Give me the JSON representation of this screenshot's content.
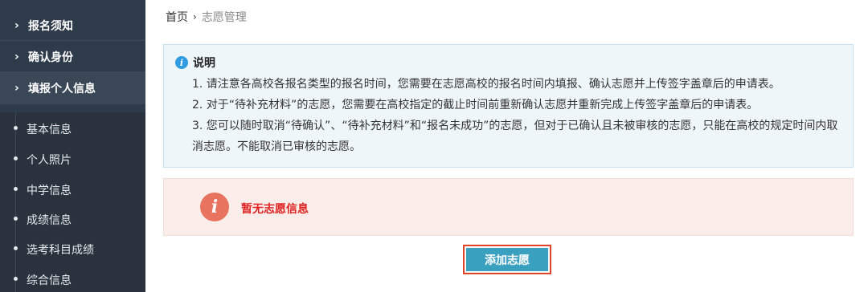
{
  "sidebar": {
    "sections": [
      {
        "label": "报名须知"
      },
      {
        "label": "确认身份"
      },
      {
        "label": "填报个人信息"
      }
    ],
    "subitems": [
      {
        "label": "基本信息"
      },
      {
        "label": "个人照片"
      },
      {
        "label": "中学信息"
      },
      {
        "label": "成绩信息"
      },
      {
        "label": "选考科目成绩"
      },
      {
        "label": "综合信息"
      }
    ]
  },
  "breadcrumb": {
    "home": "首页",
    "separator": "›",
    "current": "志愿管理"
  },
  "info": {
    "title": "说明",
    "lines": [
      "1. 请注意各高校各报名类型的报名时间，您需要在志愿高校的报名时间内填报、确认志愿并上传签字盖章后的申请表。",
      "2. 对于“待补充材料”的志愿，您需要在高校指定的截止时间前重新确认志愿并重新完成上传签字盖章后的申请表。",
      "3. 您可以随时取消“待确认”、“待补充材料”和“报名未成功”的志愿，但对于已确认且未被审核的志愿，只能在高校的规定时间内取消志愿。不能取消已审核的志愿。"
    ]
  },
  "notice": {
    "text": "暂无志愿信息"
  },
  "actions": {
    "add_label": "添加志愿"
  },
  "icons": {
    "chevron": "chevron-right-icon",
    "info": "info-icon",
    "alert": "alert-info-icon"
  },
  "colors": {
    "sidebar_bg": "#2e3b4b",
    "accent_button": "#3aa0bf",
    "notice_text": "#e02020",
    "info_icon": "#2f9be0"
  }
}
